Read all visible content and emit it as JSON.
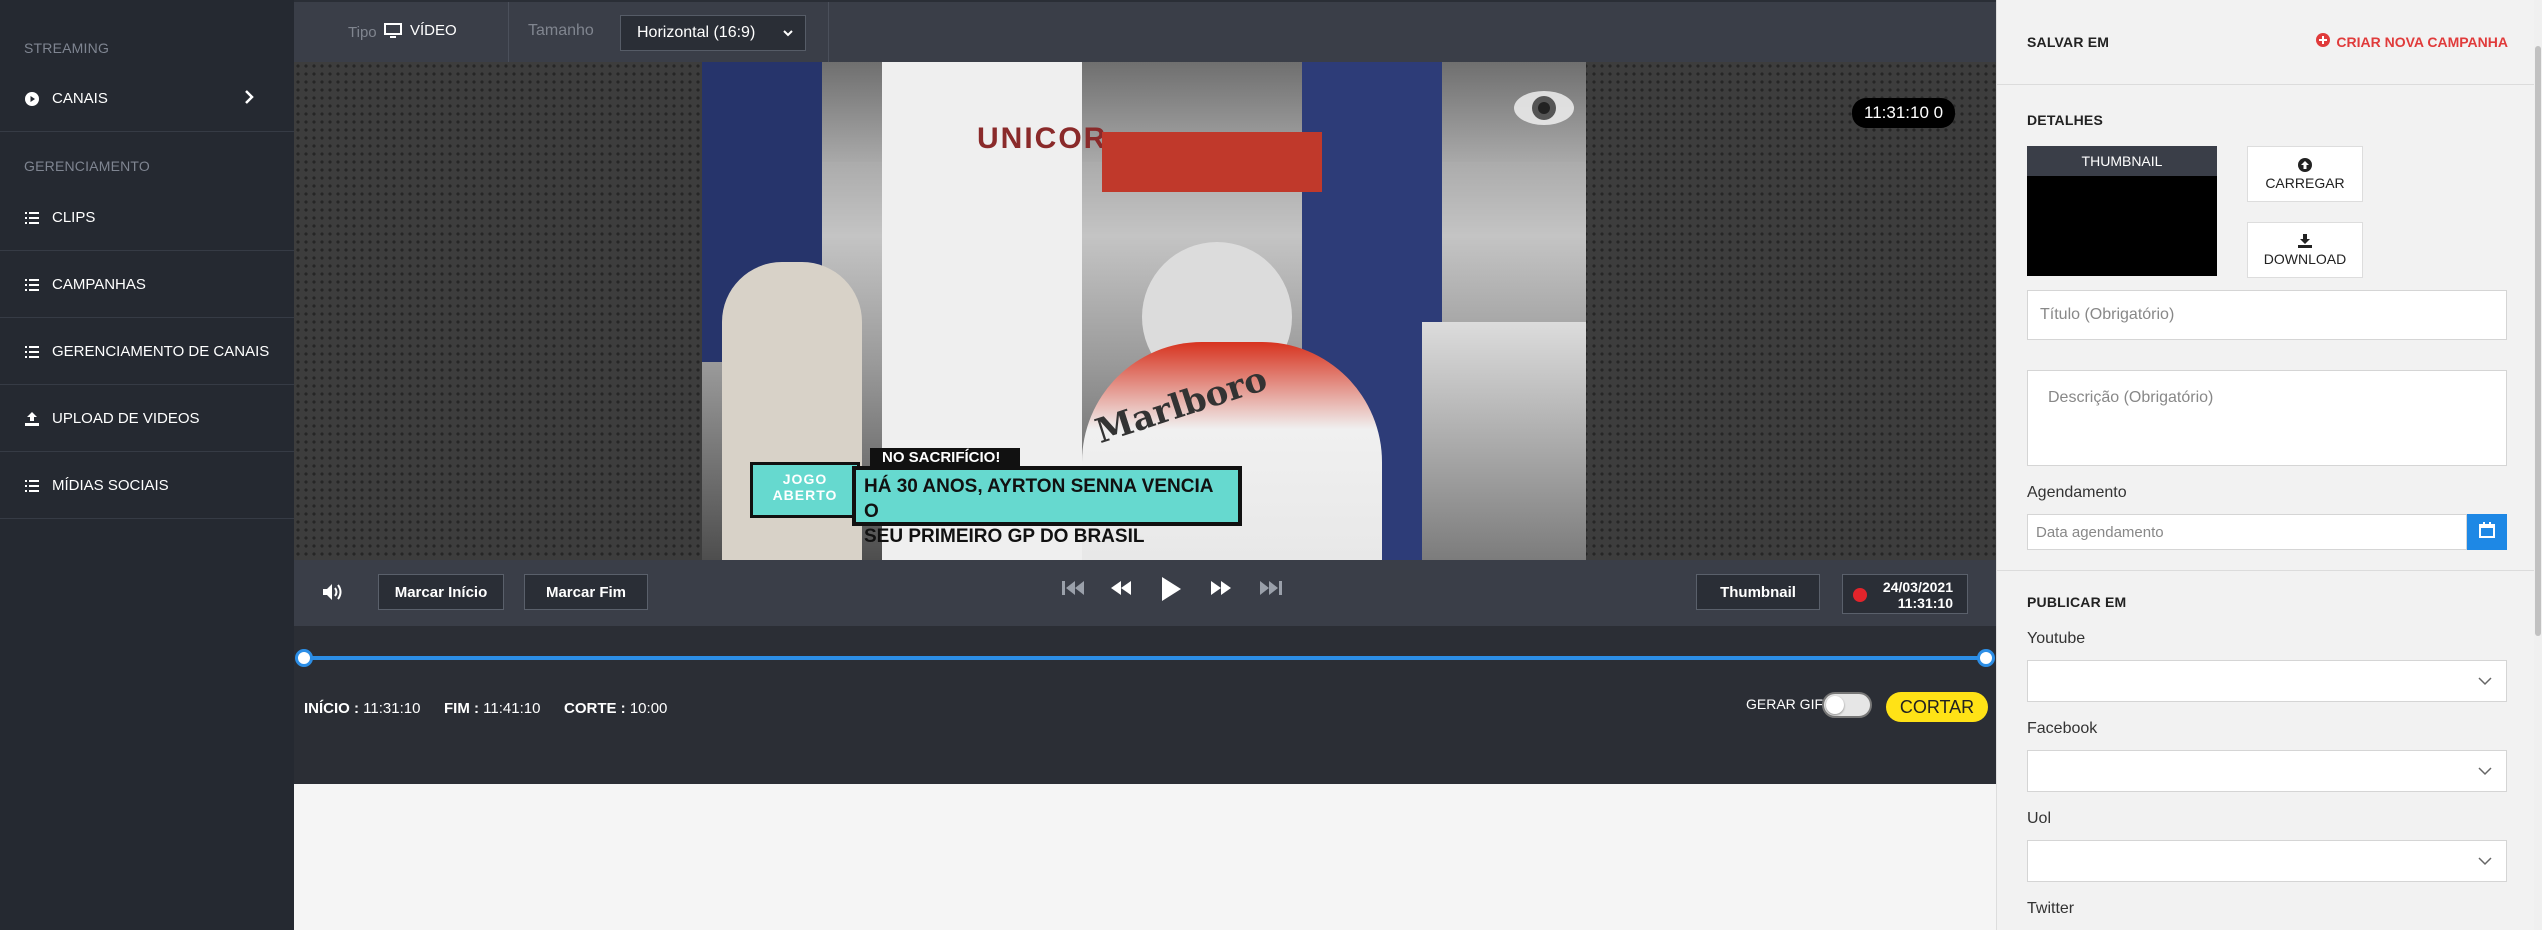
{
  "sidebar": {
    "sections": [
      "STREAMING",
      "GERENCIAMENTO"
    ],
    "items": [
      {
        "label": "CANAIS",
        "icon": "play-circle-icon"
      },
      {
        "label": "CLIPS",
        "icon": "list-icon"
      },
      {
        "label": "CAMPANHAS",
        "icon": "list-icon"
      },
      {
        "label": "GERENCIAMENTO DE CANAIS",
        "icon": "list-icon"
      },
      {
        "label": "UPLOAD DE VIDEOS",
        "icon": "upload-icon"
      },
      {
        "label": "MÍDIAS SOCIAIS",
        "icon": "list-icon"
      }
    ]
  },
  "toolbar": {
    "tipo_label": "Tipo",
    "tipo_value": "VÍDEO",
    "tamanho_label": "Tamanho",
    "tamanho_value": "Horizontal (16:9)"
  },
  "video": {
    "timecode": "11:31:10 0",
    "banner_top": "NO SACRIFÍCIO!",
    "banner_line1": "HÁ 30 ANOS, AYRTON SENNA VENCIA O",
    "banner_line2": "SEU PRIMEIRO GP DO BRASIL",
    "logo_line1": "JOGO",
    "logo_line2": "ABERTO",
    "shirt_text": "UNICOR",
    "car_text": "Marlboro"
  },
  "controls": {
    "mark_start": "Marcar Início",
    "mark_end": "Marcar Fim",
    "thumbnail": "Thumbnail",
    "live_date": "24/03/2021",
    "live_time": "11:31:10"
  },
  "timeline": {
    "inicio_label": "INÍCIO :",
    "inicio_value": "11:31:10",
    "fim_label": "FIM :",
    "fim_value": "11:41:10",
    "corte_label": "CORTE :",
    "corte_value": "10:00",
    "gif_label": "GERAR GIF",
    "gif_enabled": false,
    "cut_button": "CORTAR"
  },
  "panel": {
    "save_in": "SALVAR EM",
    "new_campaign": "CRIAR NOVA CAMPANHA",
    "details": "DETALHES",
    "thumbnail": "THUMBNAIL",
    "upload": "CARREGAR",
    "download": "DOWNLOAD",
    "title_placeholder": "Título (Obrigatório)",
    "description_placeholder": "Descrição (Obrigatório)",
    "schedule_label": "Agendamento",
    "schedule_placeholder": "Data agendamento",
    "publish_in": "PUBLICAR EM",
    "platforms": [
      "Youtube",
      "Facebook",
      "Uol",
      "Twitter"
    ]
  },
  "colors": {
    "sidebar_bg": "#252931",
    "accent_blue": "#2c8ee6",
    "cut_yellow": "#ffe216",
    "danger_red": "#e03b3b",
    "live_red": "#e3242b"
  }
}
